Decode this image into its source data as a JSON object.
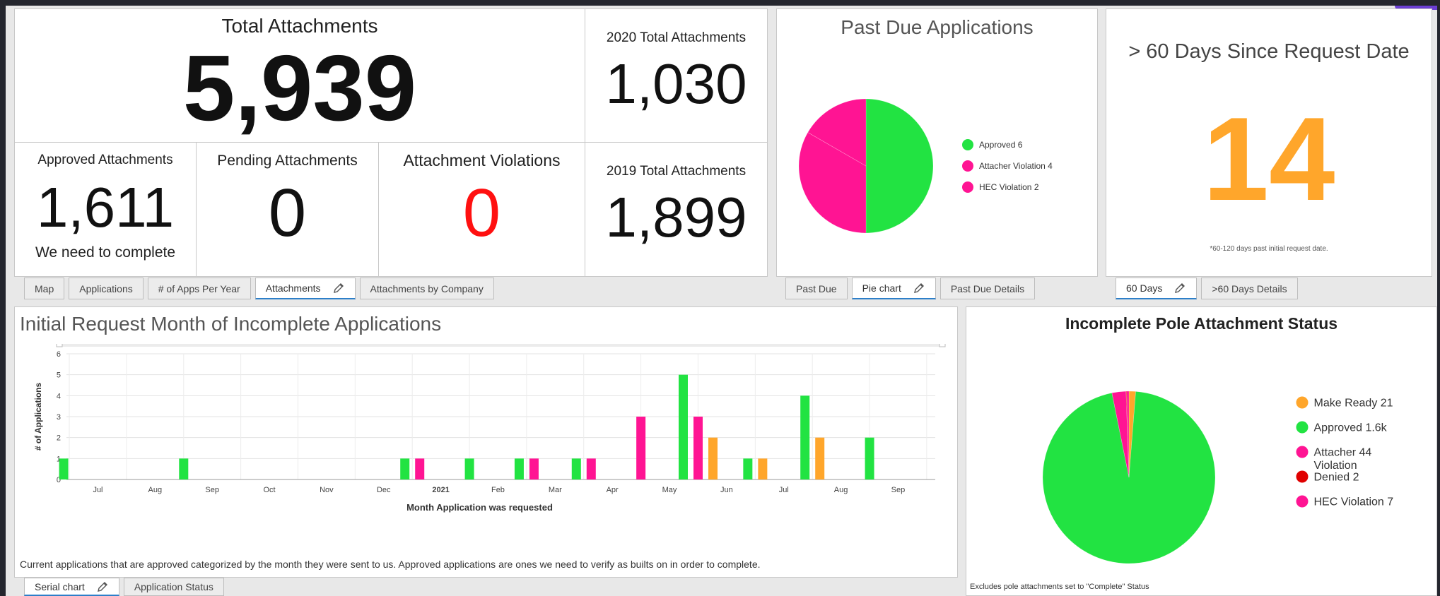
{
  "colors": {
    "green": "#22e342",
    "pink": "#ff1493",
    "orange": "#ffa62b",
    "red": "#e00000",
    "violation_red": "#ff1010"
  },
  "kpi": {
    "total": {
      "title": "Total Attachments",
      "value": "5,939"
    },
    "y2020": {
      "title": "2020 Total Attachments",
      "value": "1,030"
    },
    "y2019": {
      "title": "2019 Total Attachments",
      "value": "1,899"
    },
    "approved": {
      "title": "Approved Attachments",
      "value": "1,611",
      "subtitle": "We need to complete"
    },
    "pending": {
      "title": "Pending Attachments",
      "value": "0"
    },
    "violations": {
      "title": "Attachment Violations",
      "value": "0"
    }
  },
  "tabs_left": {
    "items": [
      {
        "label": "Map"
      },
      {
        "label": "Applications"
      },
      {
        "label": "# of Apps Per Year"
      },
      {
        "label": "Attachments",
        "icon": "pencil-icon"
      },
      {
        "label": "Attachments by Company"
      }
    ],
    "active": "Attachments"
  },
  "past_due": {
    "title": "Past Due Applications",
    "tabs": [
      {
        "label": "Past Due"
      },
      {
        "label": "Pie chart",
        "icon": "pencil-icon"
      },
      {
        "label": "Past Due Details"
      }
    ],
    "active_tab": "Pie chart"
  },
  "days60": {
    "title": "> 60 Days Since Request Date",
    "value": "14",
    "footnote": "*60-120 days past initial request date.",
    "tabs": [
      {
        "label": "60 Days",
        "icon": "pencil-icon"
      },
      {
        "label": ">60 Days Details"
      }
    ],
    "active_tab": "60 Days"
  },
  "serial": {
    "title": "Initial Request Month of Incomplete Applications",
    "caption": "Current applications that are approved categorized by the month they were sent to us. Approved applications are ones we need to verify as builts on in order to complete.",
    "tabs": [
      {
        "label": "Serial chart",
        "icon": "pencil-icon"
      },
      {
        "label": "Application Status"
      }
    ],
    "active_tab": "Serial chart"
  },
  "status": {
    "title": "Incomplete Pole Attachment Status",
    "footnote": "Excludes pole attachments set to \"Complete\" Status"
  },
  "chart_data": [
    {
      "type": "pie",
      "labels": [
        "Approved",
        "Attacher Violation",
        "HEC Violation"
      ],
      "values": [
        6,
        4,
        2
      ],
      "legend_text": [
        "Approved  6",
        "Attacher Violation  4",
        "HEC Violation  2"
      ],
      "colors": [
        "#22e342",
        "#ff1493",
        "#ff1493"
      ],
      "legend": "right"
    },
    {
      "type": "bar",
      "xlabel": "Month Application was requested",
      "ylabel": "# of Applications",
      "ylim": [
        0,
        6
      ],
      "yticks": [
        0,
        1,
        2,
        3,
        4,
        5,
        6
      ],
      "month_ticks": [
        "Jul",
        "Aug",
        "Sep",
        "Oct",
        "Nov",
        "Dec",
        "2021",
        "Feb",
        "Mar",
        "Apr",
        "May",
        "Jun",
        "Jul",
        "Aug",
        "Sep"
      ],
      "grid": true,
      "bars": [
        {
          "month": "2020-06",
          "color": "#22e342",
          "value": 1
        },
        {
          "month": "2020-08",
          "color": "#22e342",
          "value": 1
        },
        {
          "month": "2020-12",
          "color": "#22e342",
          "value": 1
        },
        {
          "month": "2020-12",
          "color": "#ff1493",
          "value": 1
        },
        {
          "month": "2021-01",
          "color": "#22e342",
          "value": 1
        },
        {
          "month": "2021-02",
          "color": "#22e342",
          "value": 1
        },
        {
          "month": "2021-02",
          "color": "#ff1493",
          "value": 1
        },
        {
          "month": "2021-03",
          "color": "#22e342",
          "value": 1
        },
        {
          "month": "2021-03",
          "color": "#ff1493",
          "value": 1
        },
        {
          "month": "2021-04",
          "color": "#ff1493",
          "value": 3
        },
        {
          "month": "2021-05",
          "color": "#22e342",
          "value": 5
        },
        {
          "month": "2021-05",
          "color": "#ff1493",
          "value": 3
        },
        {
          "month": "2021-05",
          "color": "#ffa62b",
          "value": 2
        },
        {
          "month": "2021-06",
          "color": "#22e342",
          "value": 1
        },
        {
          "month": "2021-06",
          "color": "#ffa62b",
          "value": 1
        },
        {
          "month": "2021-07",
          "color": "#22e342",
          "value": 4
        },
        {
          "month": "2021-07",
          "color": "#ffa62b",
          "value": 2
        },
        {
          "month": "2021-08",
          "color": "#22e342",
          "value": 2
        }
      ]
    },
    {
      "type": "pie",
      "labels": [
        "Make Ready",
        "Approved",
        "Attacher Violation",
        "Denied",
        "HEC Violation"
      ],
      "values": [
        21,
        1600,
        44,
        2,
        7
      ],
      "legend_values": [
        "21",
        "1.6k",
        "44",
        "2",
        "7"
      ],
      "colors": [
        "#ffa62b",
        "#22e342",
        "#ff1493",
        "#e00000",
        "#ff1493"
      ],
      "legend": "right"
    }
  ]
}
